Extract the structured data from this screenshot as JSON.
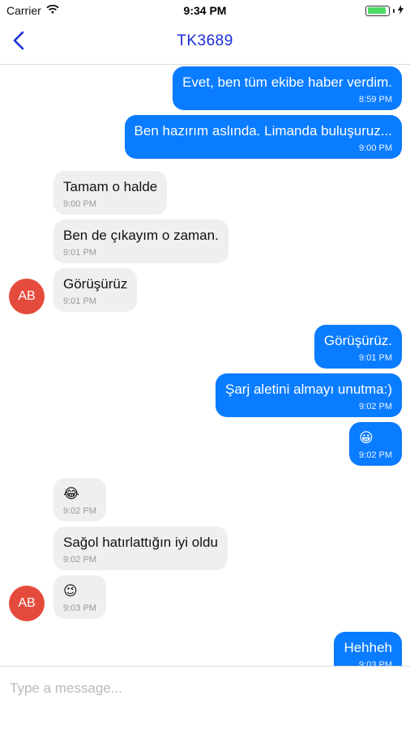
{
  "status_bar": {
    "carrier": "Carrier",
    "time": "9:34 PM",
    "battery_level": 0.9,
    "icons": [
      "wifi-icon",
      "battery-icon",
      "charging-icon"
    ]
  },
  "header": {
    "title": "TK3689",
    "back_icon": "chevron-left-icon",
    "accent": "#1a2fd6"
  },
  "colors": {
    "outgoing_bubble": "#0a7cff",
    "incoming_bubble": "#efefef",
    "avatar": "#e54b3d"
  },
  "messages": [
    {
      "dir": "out",
      "text": "Evet, ben tüm ekibe haber verdim.",
      "time": "8:59 PM"
    },
    {
      "dir": "out",
      "text": "Ben hazırım aslında. Limanda buluşuruz...",
      "time": "9:00 PM"
    },
    {
      "dir": "in",
      "text": "Tamam o halde",
      "time": "9:00 PM"
    },
    {
      "dir": "in",
      "text": "Ben de çıkayım o zaman.",
      "time": "9:01 PM"
    },
    {
      "dir": "in",
      "text": "Görüşürüz",
      "time": "9:01 PM"
    },
    {
      "dir": "out",
      "text": "Görüşürüz.",
      "time": "9:01 PM"
    },
    {
      "dir": "out",
      "text": "Şarj aletini almayı unutma:)",
      "time": "9:02 PM"
    },
    {
      "dir": "out",
      "text": "😀",
      "time": "9:02 PM"
    },
    {
      "dir": "in",
      "text": "😂",
      "time": "9:02 PM"
    },
    {
      "dir": "in",
      "text": "Sağol hatırlattığın iyi oldu",
      "time": "9:02 PM"
    },
    {
      "dir": "in",
      "text": "😉",
      "time": "9:03 PM"
    },
    {
      "dir": "out",
      "text": "Hehheh",
      "time": "9:03 PM"
    }
  ],
  "avatars": [
    {
      "initials": "AB"
    },
    {
      "initials": "AB"
    }
  ],
  "composer": {
    "placeholder": "Type a message..."
  }
}
